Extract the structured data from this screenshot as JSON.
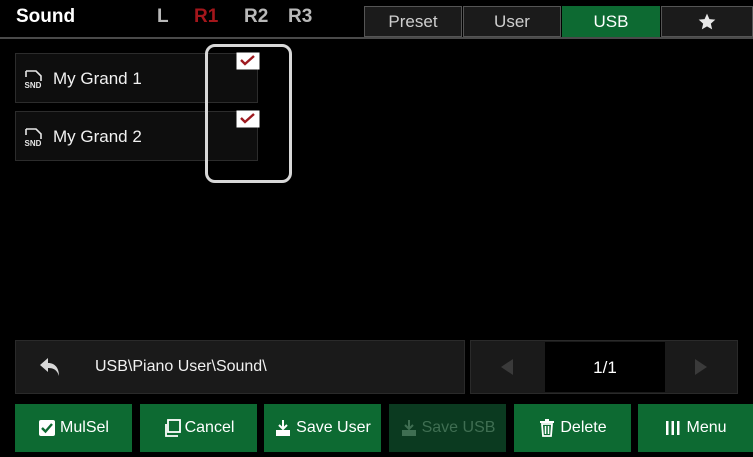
{
  "header": {
    "title": "Sound",
    "parts": [
      "L",
      "R1",
      "R2",
      "R3"
    ],
    "active_part": "R1",
    "tabs": [
      {
        "label": "Preset",
        "active": false
      },
      {
        "label": "User",
        "active": false
      },
      {
        "label": "USB",
        "active": true
      }
    ],
    "favorites_icon": "star-icon",
    "colors": {
      "accent_green": "#0d6a32",
      "active_part_red": "#a3161b"
    }
  },
  "files": [
    {
      "icon": "snd-file-icon",
      "icon_text": "SND",
      "name": "My Grand 1",
      "checked": true
    },
    {
      "icon": "snd-file-icon",
      "icon_text": "SND",
      "name": "My Grand 2",
      "checked": true
    }
  ],
  "path": {
    "back_icon": "back-arrow-icon",
    "text": "USB\\Piano User\\Sound\\"
  },
  "pagination": {
    "prev_icon": "triangle-left-icon",
    "next_icon": "triangle-right-icon",
    "page": "1/1"
  },
  "buttons": {
    "mulsel": "MulSel",
    "cancel": "Cancel",
    "save_user": "Save User",
    "save_usb": "Save USB",
    "delete": "Delete",
    "menu": "Menu"
  }
}
